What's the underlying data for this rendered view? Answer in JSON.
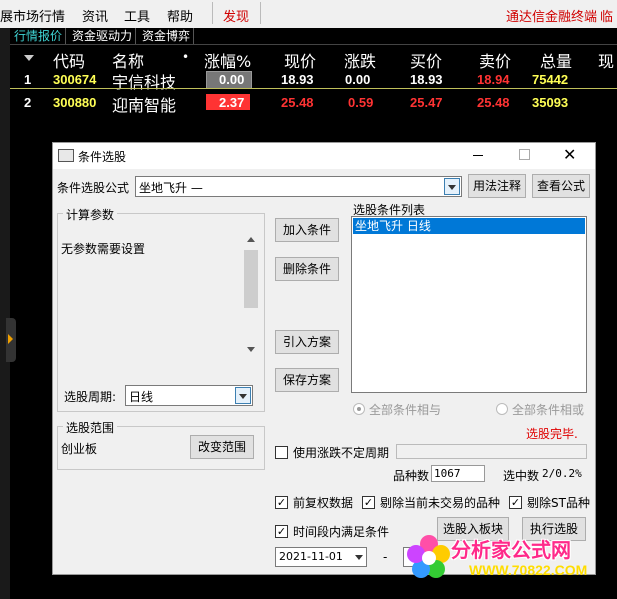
{
  "menubar": {
    "items": [
      "展市场行情",
      "资讯",
      "工具",
      "帮助",
      "发现"
    ],
    "right_text": "通达信金融终端",
    "right_tail": "临"
  },
  "tabs": [
    "行情报价",
    "资金驱动力",
    "资金博弈"
  ],
  "table": {
    "headers": [
      "代码",
      "名称",
      "•",
      "涨幅%",
      "现价",
      "涨跌",
      "买价",
      "卖价",
      "总量",
      "现"
    ],
    "rows": [
      {
        "idx": "1",
        "code": "300674",
        "name": "宇信科技",
        "pct": "0.00",
        "price": "18.93",
        "chg": "0.00",
        "buy": "18.93",
        "sell": "18.94",
        "vol": "75442"
      },
      {
        "idx": "2",
        "code": "300880",
        "name": "迎南智能",
        "pct": "2.37",
        "price": "25.48",
        "chg": "0.59",
        "buy": "25.47",
        "sell": "25.48",
        "vol": "35093"
      }
    ]
  },
  "dialog": {
    "title": "条件选股",
    "formula_label": "条件选股公式",
    "formula_value": "坐地飞升        —",
    "usage_btn": "用法注释",
    "view_btn": "查看公式",
    "params_title": "计算参数",
    "params_text": "无参数需要设置",
    "period_label": "选股周期:",
    "period_value": "日线",
    "scope_title": "选股范围",
    "scope_value": "创业板",
    "scope_btn": "改变范围",
    "add_btn": "加入条件",
    "del_btn": "删除条件",
    "import_btn": "引入方案",
    "save_btn": "保存方案",
    "list_title": "选股条件列表",
    "list_item": "坐地飞升  日线",
    "radio_and": "全部条件相与",
    "radio_or": "全部条件相或",
    "status": "选股完毕.",
    "use_range_label": "使用涨跌不定周期",
    "count_label": "品种数",
    "count_value": "1067",
    "selected_label": "选中数",
    "selected_value": "2/0.2%",
    "chk_prev": "前复权数据",
    "chk_exclude_halt": "剔除当前未交易的品种",
    "chk_exclude_st": "剔除ST品种",
    "chk_interval": "时间段内满足条件",
    "to_block_btn": "选股入板块",
    "exec_btn": "执行选股",
    "date_value": "2021-11-01",
    "dash": "-"
  },
  "watermark": {
    "line1": "分析家公式网",
    "line2": "WWW.70822.COM"
  },
  "colors": {
    "up": "#ff3333",
    "down_label_bg": "#ff3333",
    "code_yellow": "#ffff55",
    "cyan": "#3fd3d3"
  }
}
